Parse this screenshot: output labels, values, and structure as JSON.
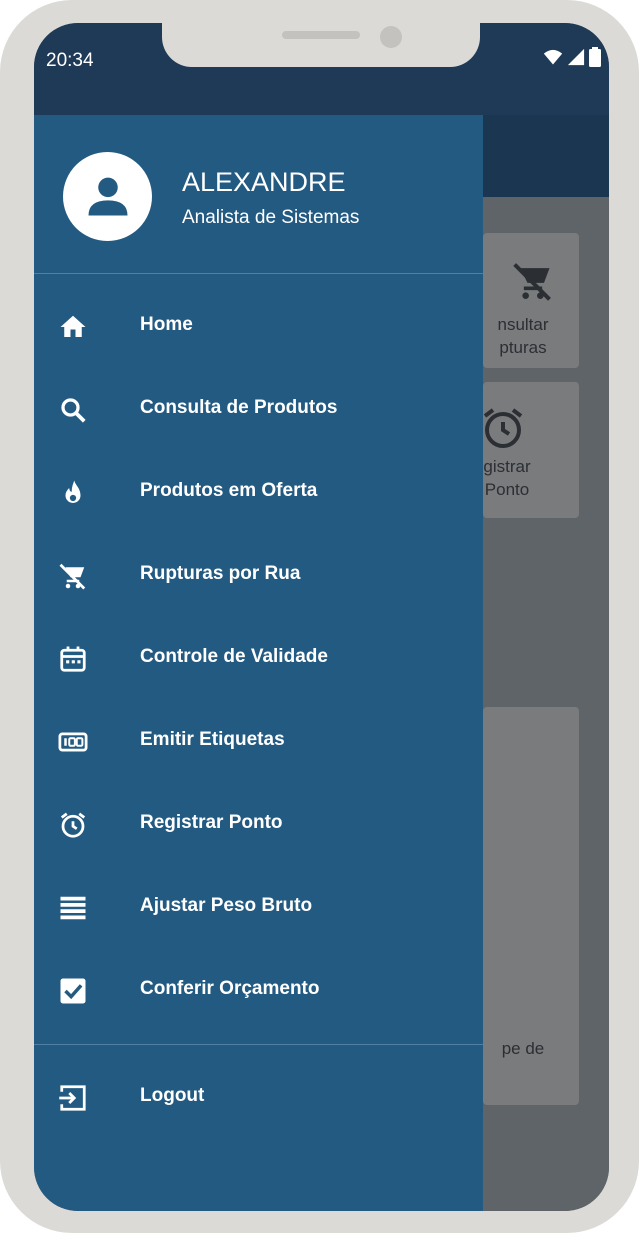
{
  "status": {
    "time": "20:34"
  },
  "background": {
    "cards": [
      {
        "line1": "nsultar",
        "line2": "pturas"
      },
      {
        "line1": "gistrar",
        "line2": "Ponto"
      },
      {
        "line1": "pe de",
        "line2": ""
      }
    ]
  },
  "user": {
    "name": "ALEXANDRE",
    "role": "Analista de Sistemas"
  },
  "menu": {
    "items": [
      {
        "label": "Home",
        "icon": "home-icon"
      },
      {
        "label": "Consulta de Produtos",
        "icon": "search-icon"
      },
      {
        "label": "Produtos em Oferta",
        "icon": "fire-icon"
      },
      {
        "label": "Rupturas por Rua",
        "icon": "cart-off-icon"
      },
      {
        "label": "Controle de Validade",
        "icon": "calendar-icon"
      },
      {
        "label": "Emitir Etiquetas",
        "icon": "label-icon"
      },
      {
        "label": "Registrar Ponto",
        "icon": "alarm-icon"
      },
      {
        "label": "Ajustar Peso Bruto",
        "icon": "list-icon"
      },
      {
        "label": "Conferir Orçamento",
        "icon": "checkbox-icon"
      }
    ],
    "logout": {
      "label": "Logout",
      "icon": "logout-icon"
    }
  },
  "colors": {
    "drawer": "#235a82",
    "statusbar": "#1e3a57",
    "scrim": "#5d6266"
  }
}
